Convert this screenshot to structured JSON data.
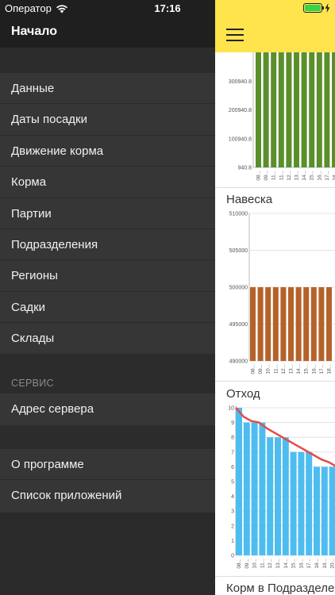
{
  "status_bar": {
    "carrier": "Оператор",
    "time": "17:16"
  },
  "sidebar": {
    "title": "Начало",
    "menu_items": [
      "Данные",
      "Даты посадки",
      "Движение корма",
      "Корма",
      "Партии",
      "Подразделения",
      "Регионы",
      "Садки",
      "Склады"
    ],
    "section_service": "СЕРВИС",
    "service_items": [
      "Адрес сервера"
    ],
    "bottom_items": [
      "О программе",
      "Список приложений"
    ]
  },
  "main": {
    "charts_titles": [
      "Навеска",
      "Отход",
      "Корм в Подразделе"
    ]
  },
  "chart_data": [
    {
      "type": "bar",
      "title": "",
      "color": "#5b8f2b",
      "yticks": [
        "300940.8",
        "200940.8",
        "100940.8",
        "940.8"
      ],
      "ylim": [
        940.8,
        400940.8
      ],
      "categories": [
        "08...",
        "09...",
        "11...",
        "11...",
        "12...",
        "13...",
        "14...",
        "15...",
        "16...",
        "17...",
        "18..."
      ],
      "values": [
        400940.8,
        400940.8,
        400940.8,
        400940.8,
        400940.8,
        400940.8,
        400940.8,
        400940.8,
        400940.8,
        400940.8,
        400940.8
      ]
    },
    {
      "type": "bar",
      "title": "Навеска",
      "color": "#b5622a",
      "yticks": [
        "510000",
        "505000",
        "500000",
        "495000",
        "490000"
      ],
      "ylim": [
        490000,
        510000
      ],
      "categories": [
        "08...",
        "09...",
        "10...",
        "11...",
        "12...",
        "13...",
        "14...",
        "15...",
        "16...",
        "17...",
        "18..."
      ],
      "values": [
        500000,
        500000,
        500000,
        500000,
        500000,
        500000,
        500000,
        500000,
        500000,
        500000,
        500000
      ]
    },
    {
      "type": "bar",
      "title": "Отход",
      "color": "#4dbdf0",
      "line_color": "#e34c4c",
      "yticks": [
        "10",
        "9",
        "8",
        "7",
        "6",
        "5",
        "4",
        "3",
        "2",
        "1",
        "0"
      ],
      "ylim": [
        0,
        10
      ],
      "categories": [
        "08...",
        "09...",
        "10...",
        "11...",
        "12...",
        "13...",
        "14...",
        "15...",
        "16...",
        "17...",
        "18...",
        "19...",
        "20..."
      ],
      "values": [
        10,
        9,
        9,
        9,
        8,
        8,
        8,
        7,
        7,
        7,
        6,
        6,
        6
      ],
      "line_values": [
        10,
        9.4,
        9.1,
        9.0,
        8.6,
        8.3,
        8.0,
        7.7,
        7.4,
        7.1,
        6.8,
        6.5,
        6.3,
        6.0
      ]
    }
  ]
}
